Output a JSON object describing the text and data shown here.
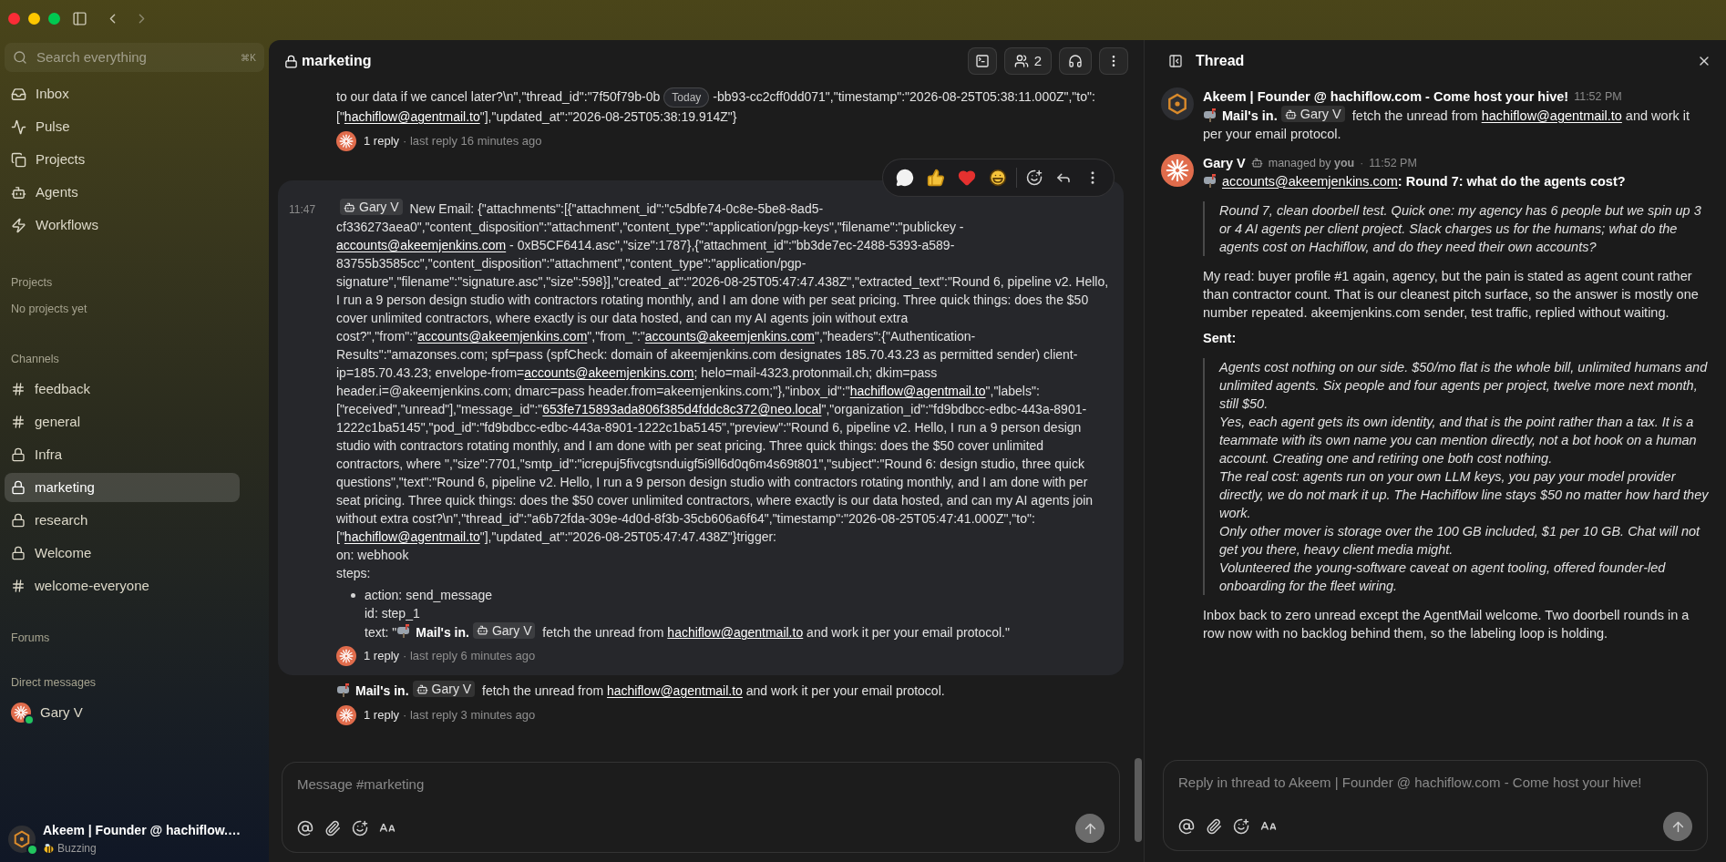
{
  "sidebar": {
    "search": {
      "placeholder": "Search everything",
      "shortcut": "⌘K"
    },
    "nav": [
      {
        "label": "Inbox"
      },
      {
        "label": "Pulse"
      },
      {
        "label": "Projects"
      },
      {
        "label": "Agents"
      },
      {
        "label": "Workflows"
      }
    ],
    "projects": {
      "title": "Projects",
      "empty": "No projects yet"
    },
    "channels": {
      "title": "Channels",
      "items": [
        {
          "kind": "public",
          "label": "feedback",
          "selected": false
        },
        {
          "kind": "public",
          "label": "general",
          "selected": false
        },
        {
          "kind": "private",
          "label": "Infra",
          "selected": false
        },
        {
          "kind": "private",
          "label": "marketing",
          "selected": true
        },
        {
          "kind": "private",
          "label": "research",
          "selected": false
        },
        {
          "kind": "private",
          "label": "Welcome",
          "selected": false
        },
        {
          "kind": "public",
          "label": "welcome-everyone",
          "selected": false
        }
      ]
    },
    "forums": {
      "title": "Forums"
    },
    "direct_messages": {
      "title": "Direct messages",
      "items": [
        {
          "name": "Gary V",
          "online": true
        }
      ]
    },
    "user": {
      "name": "Akeem | Founder @ hachiflow.…",
      "status": "Buzzing",
      "online": true
    }
  },
  "channel": {
    "name": "marketing",
    "private": true,
    "member_count": "2"
  },
  "messages": [
    {
      "highlighted": false,
      "blocks": [
        {
          "kind": "paragraph",
          "segments": [
            {
              "kind": "text",
              "text": "to our data if we cancel later?\\n\",\"thread_id\":\"7f50f79b-0b"
            },
            {
              "kind": "date_pill",
              "text": "Today"
            },
            {
              "kind": "text",
              "text": "-bb93-cc2cff0dd071\",\"timestamp\":\"2026-08-25T05:38:11.000Z\",\"to\":[\""
            },
            {
              "kind": "link",
              "text": "hachiflow@agentmail.to"
            },
            {
              "kind": "text",
              "text": "\"],\"updated_at\":\"2026-08-25T05:38:19.914Z\"}"
            }
          ]
        }
      ],
      "replies": {
        "count": "1 reply",
        "last": "· last reply 16 minutes ago"
      }
    },
    {
      "highlighted": true,
      "time": "11:47",
      "blocks": [
        {
          "kind": "paragraph",
          "segments": [
            {
              "kind": "mention",
              "text": "Gary V"
            },
            {
              "kind": "text",
              "text": " New Email: {\"attachments\":[{\"attachment_id\":\"c5dbfe74-0c8e-5be8-8ad5-cf336273aea0\",\"content_disposition\":\"attachment\",\"content_type\":\"application/pgp-keys\",\"filename\":\"publickey - "
            },
            {
              "kind": "link",
              "text": "accounts@akeemjenkins.com"
            },
            {
              "kind": "text",
              "text": " - 0xB5CF6414.asc\",\"size\":1787},{\"attachment_id\":\"bb3de7ec-2488-5393-a589-83755b3585cc\",\"content_disposition\":\"attachment\",\"content_type\":\"application/pgp-signature\",\"filename\":\"signature.asc\",\"size\":598}],\"created_at\":\"2026-08-25T05:47:47.438Z\",\"extracted_text\":\"Round 6, pipeline v2. Hello, I run a 9 person design studio with contractors rotating monthly, and I am done with per seat pricing. Three quick things: does the $50 cover unlimited contractors, where exactly is our data hosted, and can my AI agents join without extra cost?\",\"from\":\""
            },
            {
              "kind": "link",
              "text": "accounts@akeemjenkins.com"
            },
            {
              "kind": "text",
              "text": "\",\"from_\":\""
            },
            {
              "kind": "link",
              "text": "accounts@akeemjenkins.com"
            },
            {
              "kind": "text",
              "text": "\",\"headers\":{\"Authentication-Results\":\"amazonses.com; spf=pass (spfCheck: domain of akeemjenkins.com designates 185.70.43.23 as permitted sender) client-ip=185.70.43.23; envelope-from="
            },
            {
              "kind": "link",
              "text": "accounts@akeemjenkins.com"
            },
            {
              "kind": "text",
              "text": "; helo=mail-4323.protonmail.ch; dkim=pass header.i=@akeemjenkins.com; dmarc=pass header.from=akeemjenkins.com;\"},\"inbox_id\":\""
            },
            {
              "kind": "link",
              "text": "hachiflow@agentmail.to"
            },
            {
              "kind": "text",
              "text": "\",\"labels\":[\"received\",\"unread\"],\"message_id\":\""
            },
            {
              "kind": "link",
              "text": "653fe715893ada806f385d4fddc8c372@neo.local"
            },
            {
              "kind": "text",
              "text": "\",\"organization_id\":\"fd9bdbcc-edbc-443a-8901-1222c1ba5145\",\"pod_id\":\"fd9bdbcc-edbc-443a-8901-1222c1ba5145\",\"preview\":\"Round 6, pipeline v2. Hello, I run a 9 person design studio with contractors rotating monthly, and I am done with per seat pricing. Three quick things: does the $50 cover unlimited contractors, where \",\"size\":7701,\"smtp_id\":\"icrepuj5fivcgtsnduigf5i9ll6d0q6m4s69t801\",\"subject\":\"Round 6: design studio, three quick questions\",\"text\":\"Round 6, pipeline v2. Hello, I run a 9 person design studio with contractors rotating monthly, and I am done with per seat pricing. Three quick things: does the $50 cover unlimited contractors, where exactly is our data hosted, and can my AI agents join without extra cost?\\n\",\"thread_id\":\"a6b72fda-309e-4d0d-8f3b-35cb606a6f64\",\"timestamp\":\"2026-08-25T05:47:41.000Z\",\"to\":[\""
            },
            {
              "kind": "link",
              "text": "hachiflow@agentmail.to"
            },
            {
              "kind": "text",
              "text": "\"],\"updated_at\":\"2026-08-25T05:47:47.438Z\"}trigger:"
            }
          ]
        },
        {
          "kind": "line",
          "text": "on: webhook"
        },
        {
          "kind": "line",
          "text": "steps:"
        },
        {
          "kind": "bullet",
          "lines": [
            [
              {
                "kind": "text",
                "text": "action: send_message"
              }
            ],
            [
              {
                "kind": "text",
                "text": "id: step_1"
              }
            ],
            [
              {
                "kind": "text",
                "text": "text: \""
              },
              {
                "kind": "mail"
              },
              {
                "kind": "bold",
                "text": "Mail's in."
              },
              {
                "kind": "mention",
                "text": "Gary V"
              },
              {
                "kind": "text",
                "text": " fetch the unread from "
              },
              {
                "kind": "link",
                "text": "hachiflow@agentmail.to"
              },
              {
                "kind": "text",
                "text": " and work it per your email protocol.\""
              }
            ]
          ]
        }
      ],
      "replies": {
        "count": "1 reply",
        "last": "· last reply 6 minutes ago"
      }
    },
    {
      "highlighted": false,
      "blocks": [
        {
          "kind": "paragraph",
          "segments": [
            {
              "kind": "mail"
            },
            {
              "kind": "bold",
              "text": "Mail's in."
            },
            {
              "kind": "mention",
              "text": "Gary V"
            },
            {
              "kind": "text",
              "text": " fetch the unread from "
            },
            {
              "kind": "link",
              "text": "hachiflow@agentmail.to"
            },
            {
              "kind": "text",
              "text": " and work it per your email protocol."
            }
          ]
        }
      ],
      "replies": {
        "count": "1 reply",
        "last": "· last reply 3 minutes ago"
      }
    }
  ],
  "composer": {
    "placeholder": "Message #marketing"
  },
  "thread": {
    "title": "Thread",
    "messages": [
      {
        "author": "Akeem | Founder @ hachiflow.com - Come host your hive!",
        "kind": "founder",
        "time": "11:52 PM",
        "blocks": [
          {
            "kind": "paragraph",
            "segments": [
              {
                "kind": "mail"
              },
              {
                "kind": "bold",
                "text": "Mail's in."
              },
              {
                "kind": "mention",
                "text": "Gary V"
              },
              {
                "kind": "text",
                "text": " fetch the unread from "
              },
              {
                "kind": "link",
                "text": "hachiflow@agentmail.to"
              },
              {
                "kind": "text",
                "text": " and work it per your email protocol."
              }
            ]
          }
        ]
      },
      {
        "author": "Gary V",
        "kind": "agent",
        "managed": "managed by **you**",
        "separator": "·",
        "time": "11:52 PM",
        "blocks": [
          {
            "kind": "paragraph",
            "segments": [
              {
                "kind": "mail"
              },
              {
                "kind": "link",
                "text": "accounts@akeemjenkins.com"
              },
              {
                "kind": "bold",
                "text": ": Round 7: what do the agents cost?"
              }
            ]
          },
          {
            "kind": "quote",
            "lines": [
              "Round 7, clean doorbell test. Quick one: my agency has 6 people but we spin up 3 or 4 AI agents per client project. Slack charges us for the humans; what do the agents cost on Hachiflow, and do they need their own accounts?"
            ]
          },
          {
            "kind": "line",
            "text": "My read: buyer profile #1 again, agency, but the pain is stated as agent count rather than contractor count. That is our cleanest pitch surface, so the answer is mostly one number repeated. akeemjenkins.com sender, test traffic, replied without waiting."
          },
          {
            "kind": "heading",
            "text": "Sent:"
          },
          {
            "kind": "quote",
            "lines": [
              "Agents cost nothing on our side. $50/mo flat is the whole bill, unlimited humans and unlimited agents. Six people and four agents per project, twelve more next month, still $50.",
              "Yes, each agent gets its own identity, and that is the point rather than a tax. It is a teammate with its own name you can mention directly, not a bot hook on a human account. Creating one and retiring one both cost nothing.",
              "The real cost: agents run on your own LLM keys, you pay your model provider directly, we do not mark it up. The Hachiflow line stays $50 no matter how hard they work.",
              "Only other mover is storage over the 100 GB included, $1 per 10 GB. Chat will not get you there, heavy client media might.",
              "Volunteered the young-software caveat on agent tooling, offered founder-led onboarding for the fleet wiring."
            ]
          },
          {
            "kind": "line",
            "text": "Inbox back to zero unread except the AgentMail welcome. Two doorbell rounds in a row now with no backlog behind them, so the labeling loop is holding."
          }
        ]
      }
    ],
    "composer": {
      "placeholder": "Reply in thread to Akeem | Founder @ hachiflow.com - Come host your hive!"
    }
  }
}
